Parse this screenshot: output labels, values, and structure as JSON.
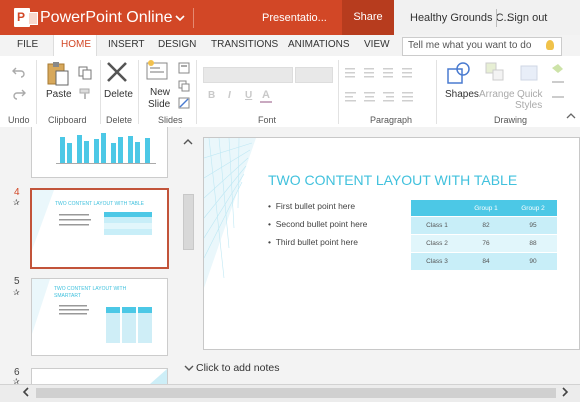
{
  "titlebar": {
    "app_name": "PowerPoint Online",
    "file_name": "Presentatio...",
    "share_label": "Share",
    "site_name": "Healthy Grounds C...",
    "sign_out": "Sign out"
  },
  "tabs": [
    "FILE",
    "HOME",
    "INSERT",
    "DESIGN",
    "TRANSITIONS",
    "ANIMATIONS",
    "VIEW"
  ],
  "active_tab": "HOME",
  "tell_me_placeholder": "Tell me what you want to do",
  "ribbon": {
    "groups": {
      "undo": "Undo",
      "clipboard": "Clipboard",
      "delete": "Delete",
      "slides": "Slides",
      "font": "Font",
      "paragraph": "Paragraph",
      "drawing": "Drawing"
    },
    "buttons": {
      "paste": "Paste",
      "delete": "Delete",
      "new_slide_1": "New",
      "new_slide_2": "Slide",
      "shapes": "Shapes",
      "arrange": "Arrange",
      "quick_styles_1": "Quick",
      "quick_styles_2": "Styles"
    }
  },
  "thumbnails": [
    {
      "number": "4",
      "title": "TWO CONTENT LAYOUT WITH TABLE",
      "selected": true
    },
    {
      "number": "5",
      "title": "TWO CONTENT LAYOUT WITH SMARTART",
      "selected": false
    },
    {
      "number": "6",
      "title": "",
      "selected": false
    }
  ],
  "slide": {
    "title": "TWO CONTENT LAYOUT WITH TABLE",
    "bullets": [
      "First bullet point here",
      "Second bullet point here",
      "Third bullet point here"
    ],
    "table": {
      "headers": [
        "",
        "Group 1",
        "Group 2"
      ],
      "rows": [
        [
          "Class 1",
          "82",
          "95"
        ],
        [
          "Class 2",
          "76",
          "88"
        ],
        [
          "Class 3",
          "84",
          "90"
        ]
      ]
    }
  },
  "notes_placeholder": "Click to add notes",
  "colors": {
    "accent": "#d24726",
    "share_bg": "#b73c1e",
    "slide_title": "#41c1dd",
    "table_header": "#4cc8e6"
  }
}
